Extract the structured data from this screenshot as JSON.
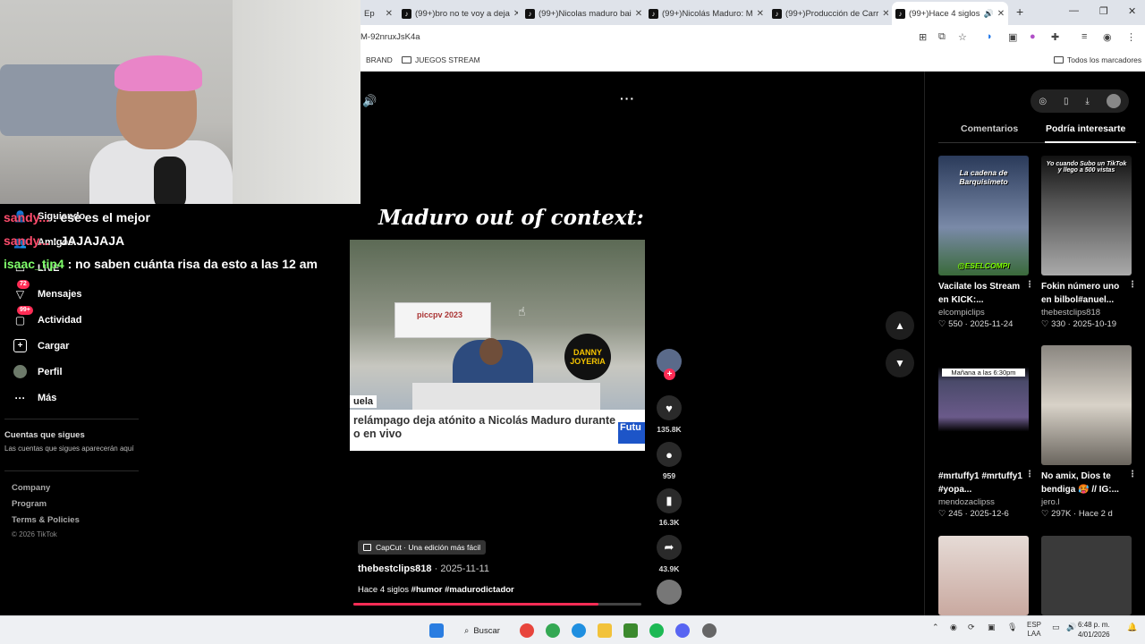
{
  "browser": {
    "tabs": [
      {
        "title": "Ep",
        "active": false
      },
      {
        "title": "(99+)bro no te voy a deja",
        "active": false
      },
      {
        "title": "(99+)Nicolas maduro bai",
        "active": false
      },
      {
        "title": "(99+)Nicolás Maduro: M",
        "active": false
      },
      {
        "title": "(99+)Producción de Carr",
        "active": false
      },
      {
        "title": "(99+)Hace 4 siglos",
        "active": true
      }
    ],
    "new_tab": "+",
    "url": "M-92nruxJsK4a",
    "bookmarks": [
      "BRAND",
      "JUEGOS STREAM"
    ],
    "all_bookmarks": "Todos los marcadores"
  },
  "chat": [
    {
      "user": "sandy...",
      "message": ": ese es el mejor"
    },
    {
      "user": "sandy...",
      "message": ": JAJAJAJA"
    },
    {
      "user": "isaac_tip4",
      "message": ": no saben cuánta risa da esto a las 12 am"
    }
  ],
  "sidebar": {
    "items": [
      {
        "label": "Siguiendo",
        "icon": "user-icon",
        "badge": ""
      },
      {
        "label": "Amigos",
        "icon": "friends-icon",
        "badge": ""
      },
      {
        "label": "LIVE",
        "icon": "live-icon",
        "badge": ""
      },
      {
        "label": "Mensajes",
        "icon": "send-icon",
        "badge": "72"
      },
      {
        "label": "Actividad",
        "icon": "inbox-icon",
        "badge": "99+"
      },
      {
        "label": "Cargar",
        "icon": "upload-icon",
        "badge": ""
      },
      {
        "label": "Perfil",
        "icon": "avatar-icon",
        "badge": ""
      },
      {
        "label": "Más",
        "icon": "more-icon",
        "badge": ""
      }
    ],
    "following_title": "Cuentas que sigues",
    "following_sub": "Las cuentas que sigues aparecerán aquí",
    "footer": [
      "Company",
      "Program",
      "Terms & Policies"
    ],
    "copyright": "© 2026 TikTok"
  },
  "video": {
    "overlay_title": "Maduro out of context:",
    "poster_text": "piccpv 2023",
    "logo_text": "DANNY JOYERIA",
    "lower_tag": "uela",
    "lower_text_1": "relámpago deja atónito a Nicolás Maduro durante",
    "lower_text_2": "o en vivo",
    "lower_brand": "Futu",
    "capcut": "CapCut · Una edición más fácil",
    "author": "thebestclips818",
    "date": "· 2025-11-11",
    "caption_text": "Hace 4 siglos",
    "caption_tags": "#humor #madurodictador",
    "progress": 0.85,
    "likes": "135.8K",
    "comments": "959",
    "saves": "16.3K",
    "shares": "43.9K"
  },
  "right_panel": {
    "tabs": [
      "Comentarios",
      "Podría interesarte"
    ],
    "active_tab": 1,
    "cards": [
      {
        "title": "Vacilate los Stream en KICK:...",
        "user": "elcompiclips",
        "likes": "550",
        "date": "2025-11-24",
        "thumb_text": "La cadena de Barquisimeto",
        "thumb_sub": "@ESELCOMPI",
        "color": "#3a4a6a"
      },
      {
        "title": "Fokin número uno en bilbol#anuel...",
        "user": "thebestclips818",
        "likes": "330",
        "date": "2025-10-19",
        "thumb_text": "Yo cuando Subo un TikTok y llego a 500 vistas",
        "thumb_sub": "",
        "color": "#6b6b6b"
      },
      {
        "title": "#mrtuffy1 #mrtuffy1 #yopa...",
        "user": "mendozaclipss",
        "likes": "245",
        "date": "2025-12-6",
        "thumb_text": "Mañana a las 6:30pm",
        "thumb_sub": "",
        "color": "#2a2a3a"
      },
      {
        "title": "No amix, Dios te bendiga 🥵 // IG:...",
        "user": "jero.l",
        "likes": "297K",
        "date": "Hace 2 d",
        "thumb_text": "",
        "thumb_sub": "",
        "color": "#b8b2a8"
      },
      {
        "title": "",
        "user": "",
        "likes": "",
        "date": "",
        "thumb_text": "",
        "thumb_sub": "",
        "color": "#c9b7b0"
      },
      {
        "title": "",
        "user": "",
        "likes": "",
        "date": "",
        "thumb_text": "",
        "thumb_sub": "",
        "color": "#3a3a3a"
      }
    ]
  },
  "taskbar": {
    "search": "Buscar",
    "lang": "ESP",
    "lang2": "LAA",
    "time": "6:48 p. m.",
    "date": "4/01/2026"
  }
}
